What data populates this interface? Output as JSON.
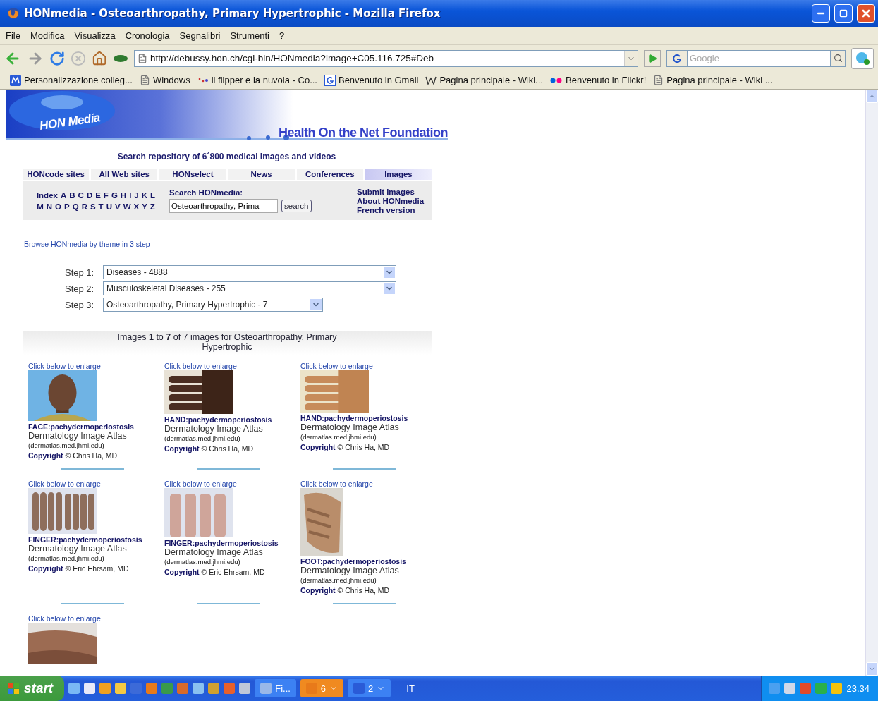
{
  "window": {
    "title": "HONmedia - Osteoarthropathy, Primary Hypertrophic - Mozilla Firefox"
  },
  "menu": [
    "File",
    "Modifica",
    "Visualizza",
    "Cronologia",
    "Segnalibri",
    "Strumenti",
    "?"
  ],
  "toolbar": {
    "url": "http://debussy.hon.ch/cgi-bin/HONmedia?image+C05.116.725#Deb",
    "search_placeholder": "Google"
  },
  "bookmarks": [
    {
      "label": "Personalizzazione colleg...",
      "kind": "m"
    },
    {
      "label": "Windows",
      "kind": "page"
    },
    {
      "label": "il flipper e la nuvola - Co...",
      "kind": "dots"
    },
    {
      "label": "Benvenuto in Gmail",
      "kind": "g"
    },
    {
      "label": "Pagina principale - Wiki...",
      "kind": "w"
    },
    {
      "label": "Benvenuto in Flickr!",
      "kind": "flickr"
    },
    {
      "label": "Pagina principale - Wiki ...",
      "kind": "page"
    }
  ],
  "page": {
    "logo": "HON Media",
    "tagline": "Health On the Net Foundation",
    "subtitle": "Search repository of 6´800 medical images and videos",
    "tabs": [
      {
        "label": "HONcode sites",
        "selected": false
      },
      {
        "label": "All Web sites",
        "selected": false
      },
      {
        "label": "HONselect",
        "selected": false
      },
      {
        "label": "News",
        "selected": false
      },
      {
        "label": "Conferences",
        "selected": false
      },
      {
        "label": "Images",
        "selected": true
      }
    ],
    "index_label": "Index",
    "letters": [
      [
        "A",
        "B",
        "C",
        "D",
        "E",
        "F",
        "G",
        "H",
        "I",
        "J",
        "K",
        "L"
      ],
      [
        "M",
        "N",
        "O",
        "P",
        "Q",
        "R",
        "S",
        "T",
        "U",
        "V",
        "W",
        "X",
        "Y",
        "Z"
      ]
    ],
    "search_label": "Search HONmedia:",
    "search_value": "Osteoarthropathy, Prima",
    "search_button": "search",
    "links": [
      "Submit images",
      "About HONmedia",
      "French version"
    ],
    "browse_link": "Browse HONmedia by theme in 3 step",
    "steps": [
      {
        "label": "Step 1:",
        "value": "Diseases - 4888"
      },
      {
        "label": "Step 2:",
        "value": "Musculoskeletal Diseases - 255"
      },
      {
        "label": "Step 3:",
        "value": "Osteoarthropathy, Primary Hypertrophic - 7"
      }
    ],
    "results_header": "Images **1** to **7** of 7 images for Osteoarthropathy, Primary Hypertrophic",
    "items": [
      {
        "hint": "Click below to enlarge",
        "title": "FACE:pachydermoperiostosis",
        "source": "Dermatology Image Atlas",
        "domain": "(dermatlas.med.jhmi.edu)",
        "copyright_label": "Copyright",
        "copyright": "© Chris Ha, MD"
      },
      {
        "hint": "Click below to enlarge",
        "title": "HAND:pachydermoperiostosis",
        "source": "Dermatology Image Atlas",
        "domain": "(dermatlas.med.jhmi.edu)",
        "copyright_label": "Copyright",
        "copyright": "© Chris Ha, MD"
      },
      {
        "hint": "Click below to enlarge",
        "title": "HAND:pachydermoperiostosis",
        "source": "Dermatology Image Atlas",
        "domain": "(dermatlas.med.jhmi.edu)",
        "copyright_label": "Copyright",
        "copyright": "© Chris Ha, MD"
      },
      {
        "hint": "Click below to enlarge",
        "title": "FINGER:pachydermoperiostosis",
        "source": "Dermatology Image Atlas",
        "domain": "(dermatlas.med.jhmi.edu)",
        "copyright_label": "Copyright",
        "copyright": "© Eric Ehrsam, MD"
      },
      {
        "hint": "Click below to enlarge",
        "title": "FINGER:pachydermoperiostosis",
        "source": "Dermatology Image Atlas",
        "domain": "(dermatlas.med.jhmi.edu)",
        "copyright_label": "Copyright",
        "copyright": "© Eric Ehrsam, MD"
      },
      {
        "hint": "Click below to enlarge",
        "title": "FOOT:pachydermoperiostosis",
        "source": "Dermatology Image Atlas",
        "domain": "(dermatlas.med.jhmi.edu)",
        "copyright_label": "Copyright",
        "copyright": "© Chris Ha, MD"
      },
      {
        "hint": "Click below to enlarge"
      }
    ]
  },
  "taskbar": {
    "start": "start",
    "tasks": [
      {
        "label": "Fi...",
        "attention": false,
        "kind": "bt"
      },
      {
        "label": "6",
        "attention": true,
        "kind": "ff"
      },
      {
        "label": "2",
        "attention": false,
        "kind": "word"
      }
    ],
    "language": "IT",
    "clock": "23.34"
  }
}
